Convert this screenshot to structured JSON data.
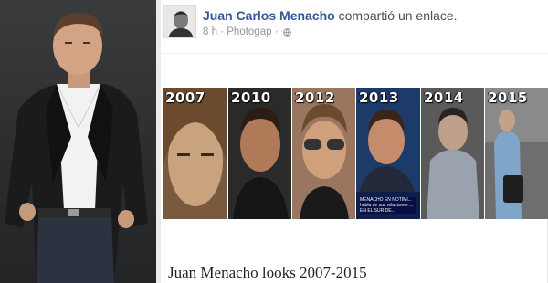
{
  "post": {
    "author": "Juan Carlos Menacho",
    "action": "compartió un enlace.",
    "time": "8 h",
    "separator": "·",
    "source": "Photogap",
    "privacy_icon": "globe-icon"
  },
  "collage": {
    "tiles": [
      {
        "year": "2007"
      },
      {
        "year": "2010"
      },
      {
        "year": "2012"
      },
      {
        "year": "2013",
        "caption": "MENACHO EN NOTIMI... habla de sus relaciones ... EN EL SUR DE..."
      },
      {
        "year": "2014"
      },
      {
        "year": "2015"
      }
    ]
  },
  "link": {
    "title": "Juan Menacho looks 2007-2015"
  },
  "colors": {
    "name_blue": "#365899",
    "meta_gray": "#90949c"
  }
}
